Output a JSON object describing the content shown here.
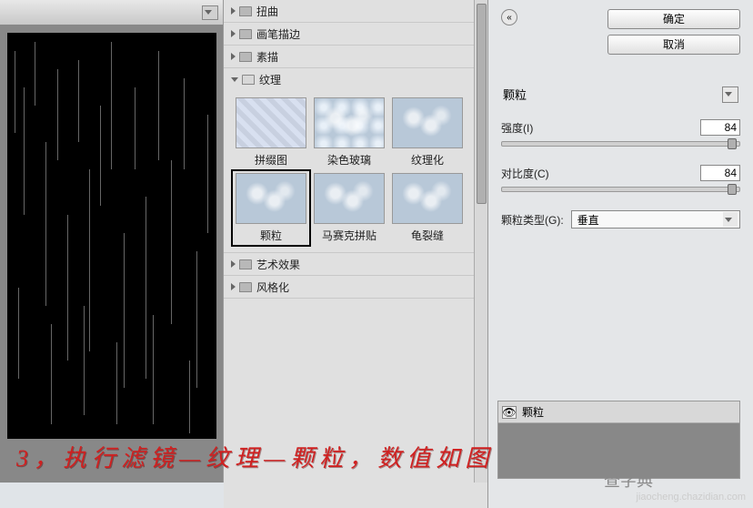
{
  "buttons": {
    "ok": "确定",
    "cancel": "取消"
  },
  "categories": {
    "distort": "扭曲",
    "brush": "画笔描边",
    "sketch": "素描",
    "texture": "纹理",
    "artistic": "艺术效果",
    "stylize": "风格化"
  },
  "thumbs": {
    "patchwork": "拼缀图",
    "stained_glass": "染色玻璃",
    "texturizer": "纹理化",
    "grain": "颗粒",
    "mosaic_tiles": "马赛克拼贴",
    "craquelure": "龟裂缝"
  },
  "filter_name": "颗粒",
  "params": {
    "intensity_label": "强度(I)",
    "intensity_value": "84",
    "contrast_label": "对比度(C)",
    "contrast_value": "84",
    "grain_type_label": "颗粒类型(G):",
    "grain_type_value": "垂直"
  },
  "layer_name": "颗粒",
  "annotation": "3，执行滤镜—纹理—颗粒，数值如图",
  "watermark1": "查字典",
  "watermark2": "jiaocheng.chazidian.com",
  "slider_pos": "95%"
}
